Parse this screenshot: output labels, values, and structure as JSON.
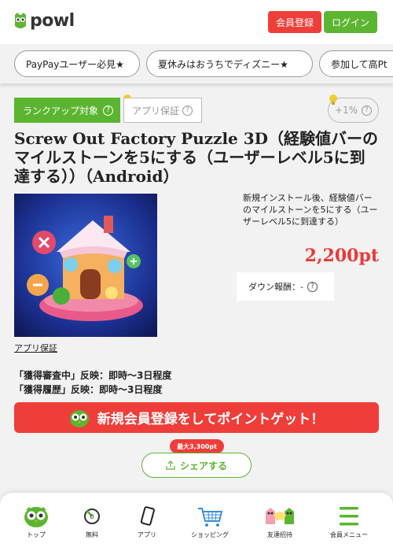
{
  "header": {
    "logo_text": "powl",
    "register_label": "会員登録",
    "login_label": "ログイン"
  },
  "tabs": [
    {
      "label": "PayPayユーザー必見★"
    },
    {
      "label": "夏休みはおうちでディズニー★"
    },
    {
      "label": "参加して高Pt"
    }
  ],
  "offer": {
    "rankup_label": "ランクアップ対象",
    "app_guarantee_tag": "アプリ保証",
    "bonus_label": "+1%",
    "title": "Screw Out Factory Puzzle 3D（経験値バーのマイルストーンを5にする（ユーザーレベル5に到達する））（Android）",
    "app_link": "アプリ保証",
    "description": "新規インストール後、経験値バーのマイルストーンを5にする（ユーザーレベル5に到達する）",
    "points": "2,200pt",
    "down_reward": "ダウン報酬：-",
    "notes": [
      "「獲得審査中」反映：即時～3日程度",
      "「獲得履歴」反映：即時～3日程度"
    ]
  },
  "cta": {
    "label": "新規会員登録をしてポイントゲット！"
  },
  "share": {
    "badge": "最大3,300pt",
    "label": "シェアする"
  },
  "bottom_nav": [
    {
      "label": "トップ",
      "icon": "owl-icon"
    },
    {
      "label": "無料",
      "icon": "free-icon"
    },
    {
      "label": "アプリ",
      "icon": "phone-icon"
    },
    {
      "label": "ショッピング",
      "icon": "cart-icon"
    },
    {
      "label": "友達招待",
      "icon": "friends-icon"
    },
    {
      "label": "会員メニュー",
      "icon": "menu-icon"
    }
  ],
  "colors": {
    "brand_green": "#5cb531",
    "brand_red": "#ef3e3a",
    "points_red": "#e83a35"
  }
}
